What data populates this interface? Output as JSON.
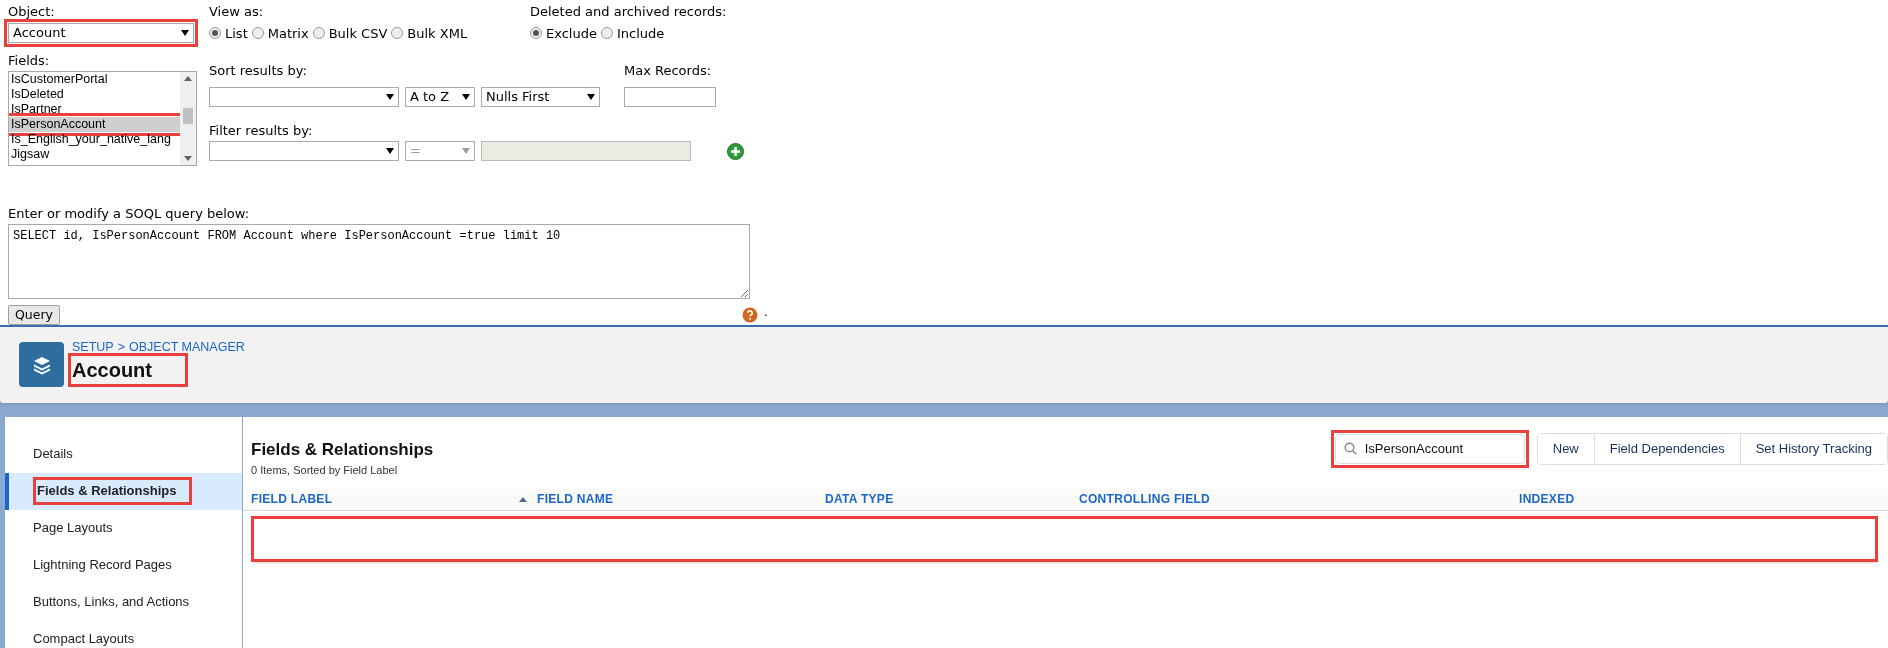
{
  "query_form": {
    "object": {
      "label": "Object:",
      "value": "Account",
      "highlighted": true
    },
    "view_as": {
      "label": "View as:",
      "options": [
        {
          "label": "List",
          "selected": true
        },
        {
          "label": "Matrix",
          "selected": false
        },
        {
          "label": "Bulk CSV",
          "selected": false
        },
        {
          "label": "Bulk XML",
          "selected": false
        }
      ]
    },
    "deleted": {
      "label": "Deleted and archived records:",
      "options": [
        {
          "label": "Exclude",
          "selected": true
        },
        {
          "label": "Include",
          "selected": false
        }
      ]
    },
    "fields": {
      "label": "Fields:",
      "items": [
        {
          "label": "IsCustomerPortal",
          "selected": false,
          "highlighted": false
        },
        {
          "label": "IsDeleted",
          "selected": false,
          "highlighted": false
        },
        {
          "label": "IsPartner",
          "selected": false,
          "highlighted": false
        },
        {
          "label": "IsPersonAccount",
          "selected": true,
          "highlighted": true
        },
        {
          "label": "Is_English_your_native_lang",
          "selected": false,
          "highlighted": false
        },
        {
          "label": "Jigsaw",
          "selected": false,
          "highlighted": false
        }
      ]
    },
    "sort": {
      "label": "Sort results by:",
      "direction": "A to Z",
      "nulls": "Nulls First"
    },
    "max_records": {
      "label": "Max Records:"
    },
    "filter": {
      "label": "Filter results by:",
      "operator": "="
    },
    "soql": {
      "label": "Enter or modify a SOQL query below:",
      "value": "SELECT id, IsPersonAccount FROM Account where IsPersonAccount =true limit 10"
    },
    "query_button": "Query",
    "dot": "."
  },
  "object_manager": {
    "breadcrumb": [
      "SETUP",
      "OBJECT MANAGER"
    ],
    "breadcrumb_separator": ">",
    "title": "Account",
    "title_highlighted": true,
    "sidebar": [
      {
        "label": "Details",
        "selected": false,
        "highlighted": false
      },
      {
        "label": "Fields & Relationships",
        "selected": true,
        "highlighted": true
      },
      {
        "label": "Page Layouts",
        "selected": false,
        "highlighted": false
      },
      {
        "label": "Lightning Record Pages",
        "selected": false,
        "highlighted": false
      },
      {
        "label": "Buttons, Links, and Actions",
        "selected": false,
        "highlighted": false
      },
      {
        "label": "Compact Layouts",
        "selected": false,
        "highlighted": false
      }
    ],
    "section": {
      "title": "Fields & Relationships",
      "subtitle": "0 Items, Sorted by Field Label"
    },
    "search": {
      "value": "IsPersonAccount",
      "highlighted": true
    },
    "buttons": [
      "New",
      "Field Dependencies",
      "Set History Tracking"
    ],
    "table": {
      "columns": [
        {
          "label": "FIELD LABEL",
          "sorted": true
        },
        {
          "label": "FIELD NAME",
          "sorted": false
        },
        {
          "label": "DATA TYPE",
          "sorted": false
        },
        {
          "label": "CONTROLLING FIELD",
          "sorted": false
        },
        {
          "label": "INDEXED",
          "sorted": false
        }
      ],
      "empty_row_highlighted": true
    }
  }
}
